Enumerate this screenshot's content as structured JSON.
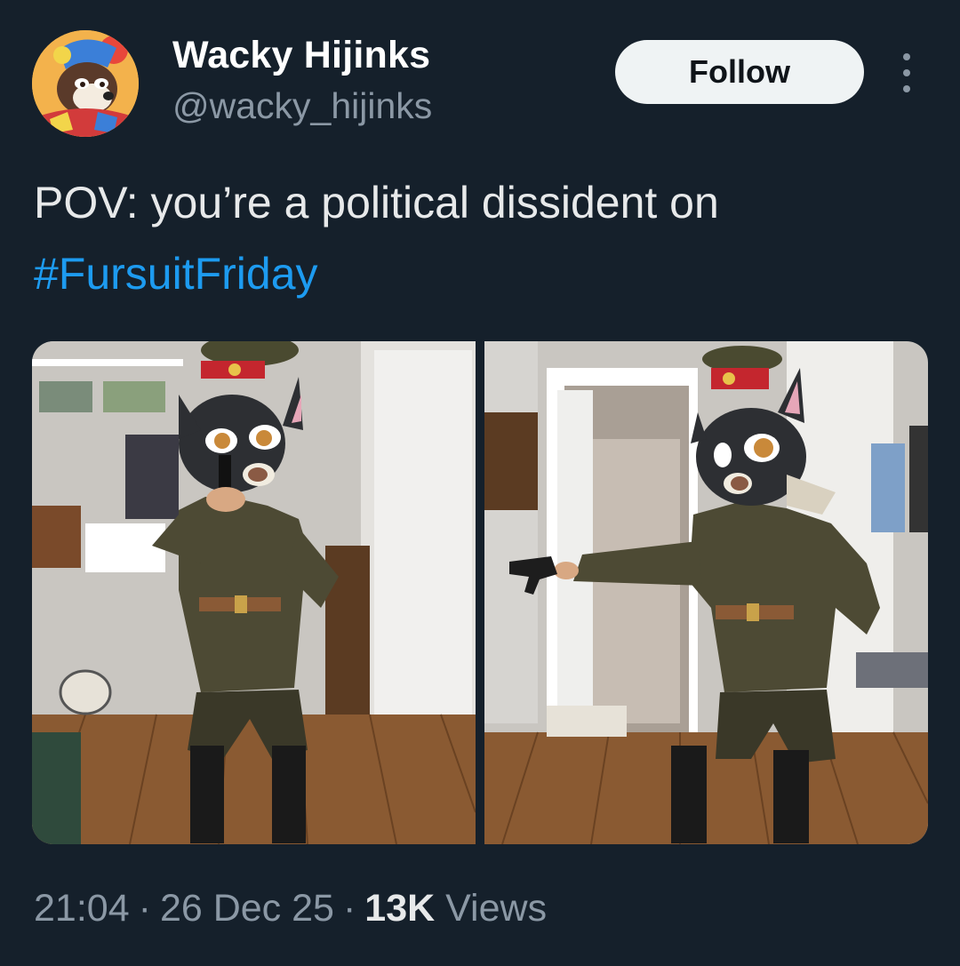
{
  "user": {
    "name": "Wacky Hijinks",
    "handle": "@wacky_hijinks",
    "avatar_icon": "clown-raccoon-avatar"
  },
  "follow_label": "Follow",
  "more_icon": "more-vertical-icon",
  "tweet": {
    "text_before": "POV: you’re a political dissident on",
    "hashtag": "#FursuitFriday"
  },
  "media": [
    {
      "icon": "photo-fursuiter-pointing-gun-at-camera"
    },
    {
      "icon": "photo-fursuiter-pointing-gun-sideways"
    }
  ],
  "meta": {
    "time": "21:04",
    "date": "26 Dec 25",
    "views_count": "13K",
    "views_label": "Views",
    "separator": "·"
  },
  "colors": {
    "background": "#15202b",
    "hashtag": "#1d9bf0",
    "muted": "#8b98a5",
    "button": "#eff3f4"
  }
}
